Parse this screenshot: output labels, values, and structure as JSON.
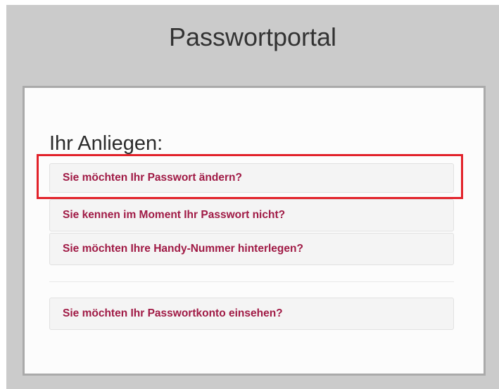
{
  "header": {
    "title": "Passwortportal"
  },
  "panel": {
    "heading": "Ihr Anliegen:",
    "options": [
      {
        "label": "Sie möchten Ihr Passwort ändern?"
      },
      {
        "label": "Sie kennen im Moment Ihr Passwort nicht?"
      },
      {
        "label": "Sie möchten Ihre Handy-Nummer hinterlegen?"
      },
      {
        "label": "Sie möchten Ihr Passwortkonto einsehen?"
      }
    ]
  },
  "colors": {
    "page_background": "#cbcbcb",
    "panel_background": "#fcfcfc",
    "link_color": "#a01a45",
    "highlight_border": "#e2222a"
  }
}
